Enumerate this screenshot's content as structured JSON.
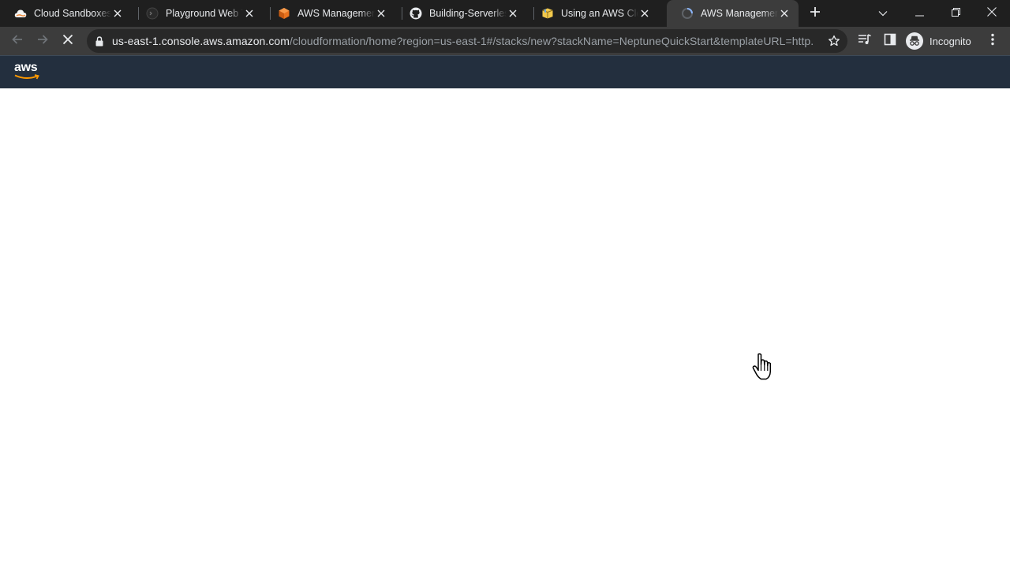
{
  "browser": {
    "tabs": [
      {
        "title": "Cloud Sandboxes - A Cloud Guru",
        "icon": "cloud-icon",
        "active": false
      },
      {
        "title": "Playground Web Terminal",
        "icon": "terminal-icon",
        "active": false
      },
      {
        "title": "AWS Management Console",
        "icon": "aws-cube-icon",
        "active": false
      },
      {
        "title": "Building-Serverless",
        "icon": "github-icon",
        "active": false
      },
      {
        "title": "Using an AWS Cloud",
        "icon": "package-icon",
        "active": false
      },
      {
        "title": "AWS Management Console",
        "icon": "loading-spinner-icon",
        "active": true
      }
    ],
    "address_bar": {
      "host": "us-east-1.console.aws.amazon.com",
      "path": "/cloudformation/home?region=us-east-1#/stacks/new?stackName=NeptuneQuickStart&templateURL=http..."
    },
    "profile_label": "Incognito"
  },
  "aws_header": {
    "logo_text": "aws"
  },
  "colors": {
    "tabstrip": "#1f1f1f",
    "toolbar": "#3c3c3c",
    "aws_header": "#232f3e",
    "aws_smile": "#ff9900"
  }
}
